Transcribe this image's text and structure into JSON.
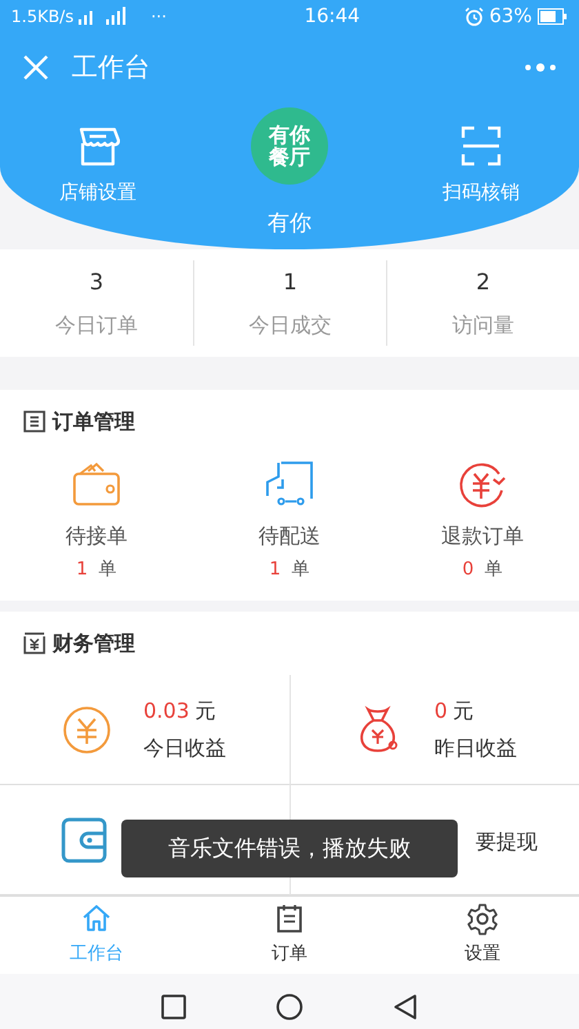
{
  "status_bar": {
    "speed": "1.5KB/s",
    "dots": "···",
    "time": "16:44",
    "battery": "63%"
  },
  "title_bar": {
    "title": "工作台"
  },
  "header": {
    "left": {
      "label": "店铺设置"
    },
    "logo": "有你餐厅",
    "shop_name": "有你",
    "right": {
      "label": "扫码核销"
    }
  },
  "stats": [
    {
      "value": "3",
      "label": "今日订单"
    },
    {
      "value": "1",
      "label": "今日成交"
    },
    {
      "value": "2",
      "label": "访问量"
    }
  ],
  "orders": {
    "title": "订单管理",
    "items": [
      {
        "kind": "wallet",
        "label": "待接单",
        "count": "1",
        "unit": "单"
      },
      {
        "kind": "truck",
        "label": "待配送",
        "count": "1",
        "unit": "单"
      },
      {
        "kind": "refund",
        "label": "退款订单",
        "count": "0",
        "unit": "单"
      }
    ]
  },
  "finance": {
    "title": "财务管理",
    "items": [
      {
        "kind": "coin",
        "amount": "0.03",
        "unit": "元",
        "label": "今日收益"
      },
      {
        "kind": "bag",
        "amount": "0",
        "unit": "元",
        "label": "昨日收益"
      },
      {
        "kind": "card"
      },
      {
        "kind": "none",
        "label": "要提现"
      }
    ]
  },
  "toast": "音乐文件错误，播放失败",
  "tab_bar": [
    {
      "kind": "home",
      "label": "工作台",
      "selected": true
    },
    {
      "kind": "orders",
      "label": "订单",
      "selected": false
    },
    {
      "kind": "settings",
      "label": "设置",
      "selected": false
    }
  ]
}
